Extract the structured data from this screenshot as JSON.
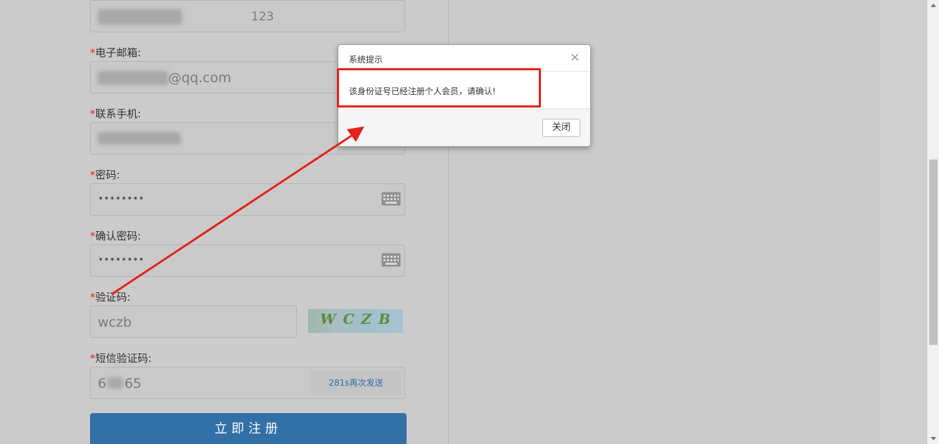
{
  "form": {
    "username_value": "123",
    "email_label": "电子邮箱:",
    "email_value": "@qq.com",
    "phone_label": "联系手机:",
    "password_label": "密码:",
    "password_value": "••••••••",
    "confirm_password_label": "确认密码:",
    "confirm_password_value": "••••••••",
    "captcha_label": "验证码:",
    "captcha_value": "wczb",
    "captcha_image_text": "WCZB",
    "sms_label": "短信验证码:",
    "sms_value_prefix": "6",
    "sms_value_suffix": "65",
    "sms_button": "281s再次发送",
    "submit_button": "立即注册",
    "required_mark": "*"
  },
  "dialog": {
    "title": "系统提示",
    "close_symbol": "×",
    "message": "该身份证号已经注册个人会员，请确认!",
    "close_button": "关闭"
  },
  "colors": {
    "annotation_red": "#e2231a",
    "submit_blue": "#3370a6",
    "required_red": "#d9281e"
  },
  "icons": {
    "keyboard": "keyboard-icon"
  }
}
